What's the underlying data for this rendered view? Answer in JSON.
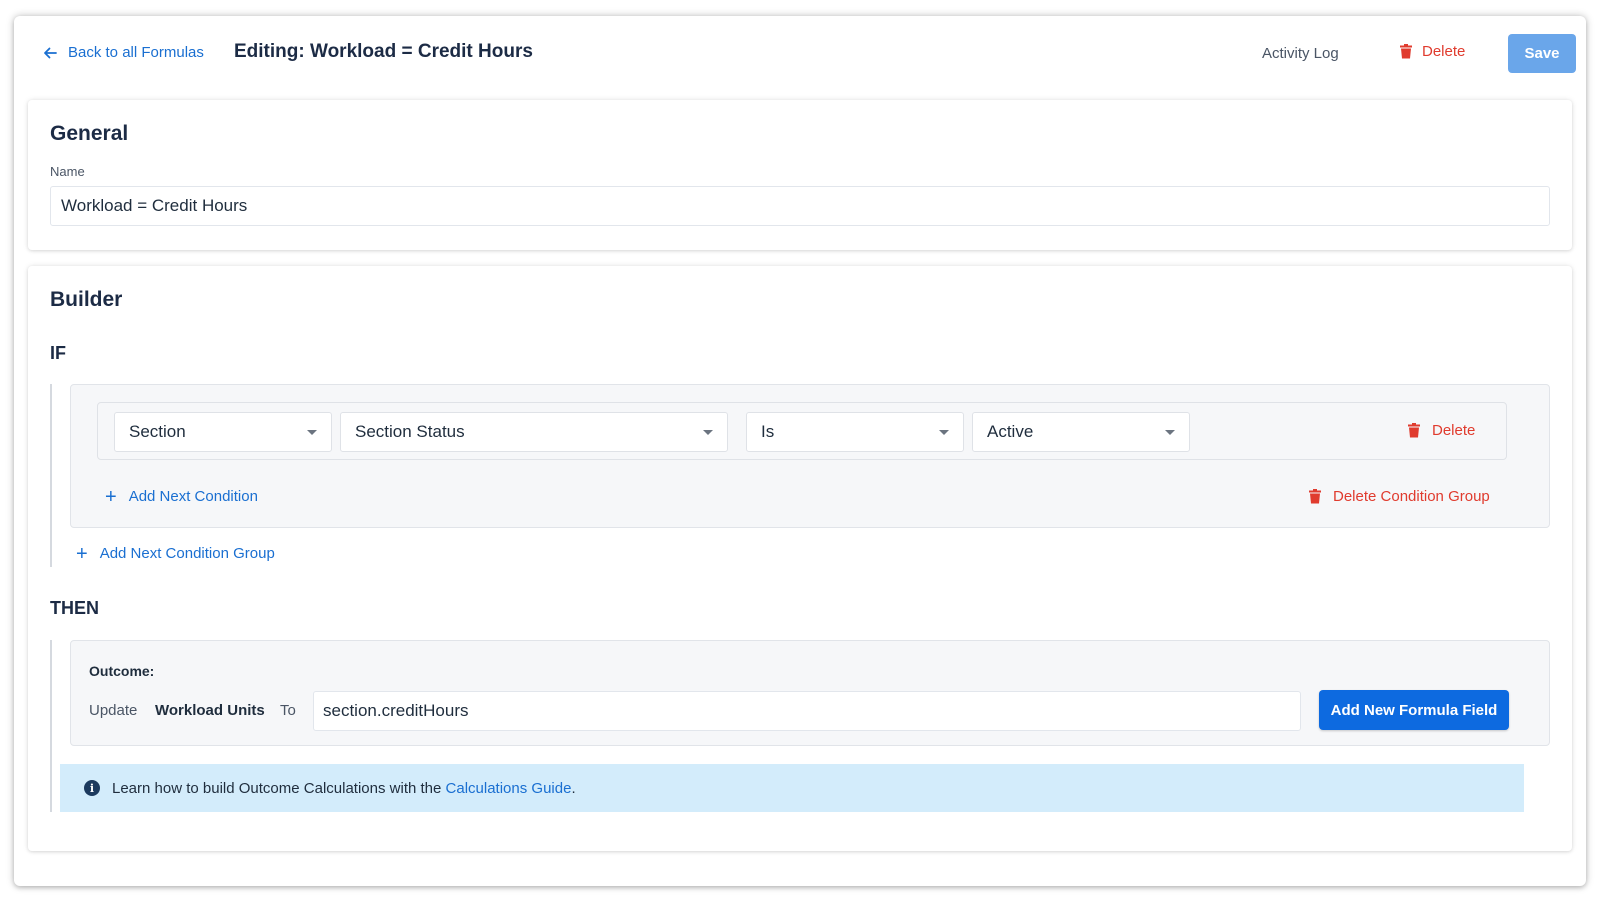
{
  "header": {
    "back_label": "Back to all Formulas",
    "title": "Editing: Workload = Credit Hours",
    "activity_log": "Activity Log",
    "delete_label": "Delete",
    "save_label": "Save"
  },
  "general": {
    "title": "General",
    "name_label": "Name",
    "name_value": "Workload = Credit Hours"
  },
  "builder": {
    "title": "Builder",
    "if_label": "IF",
    "condition": {
      "object": "Section",
      "field": "Section Status",
      "operator": "Is",
      "value": "Active",
      "delete_label": "Delete"
    },
    "add_condition": "Add Next Condition",
    "delete_group": "Delete Condition Group",
    "add_group": "Add Next Condition Group",
    "then_label": "THEN",
    "outcome": {
      "label": "Outcome:",
      "update": "Update",
      "field": "Workload Units",
      "to": "To",
      "formula": "section.creditHours",
      "add_formula_field": "Add New Formula Field"
    },
    "info": {
      "text": "Learn how to build Outcome Calculations with the",
      "link": "Calculations Guide",
      "suffix": "."
    }
  },
  "colors": {
    "accent_blue": "#0d6ae0",
    "link_blue": "#1a6fd1",
    "danger_red": "#e03b2e",
    "save_disabled": "#6aa6ea",
    "info_bg": "#d3ecfb"
  },
  "icons": [
    "arrow-left-icon",
    "trash-icon",
    "chevron-down-icon",
    "plus-icon",
    "info-icon"
  ]
}
